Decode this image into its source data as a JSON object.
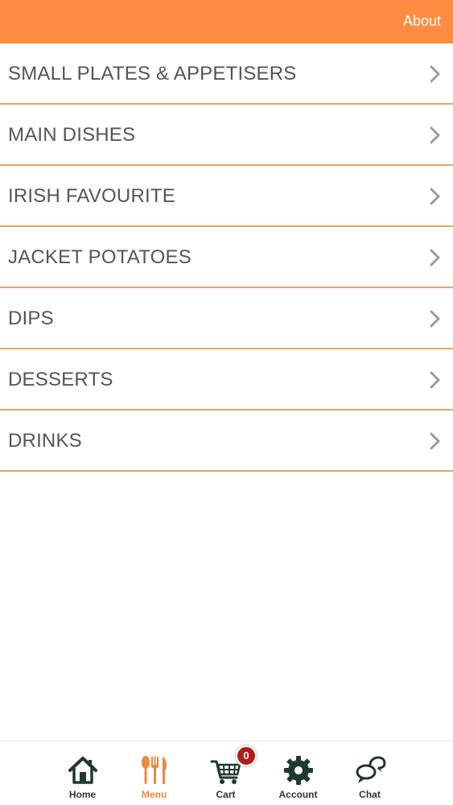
{
  "header": {
    "about_label": "About",
    "background_color": "#ff8c40"
  },
  "menu": {
    "items": [
      {
        "label": "SMALL PLATES & APPETISERS",
        "icon": "chevron-right-icon"
      },
      {
        "label": "MAIN DISHES",
        "icon": "chevron-right-icon"
      },
      {
        "label": "IRISH FAVOURITE",
        "icon": "chevron-right-icon"
      },
      {
        "label": "JACKET POTATOES",
        "icon": "chevron-right-icon"
      },
      {
        "label": "DIPS",
        "icon": "chevron-right-icon"
      },
      {
        "label": "DESSERTS",
        "icon": "chevron-right-icon"
      },
      {
        "label": "DRINKS",
        "icon": "chevron-right-icon"
      }
    ],
    "divider_color": "#e6a36e",
    "text_color": "#555555"
  },
  "tabbar": {
    "tabs": [
      {
        "label": "Home",
        "icon": "home-icon",
        "active": false
      },
      {
        "label": "Menu",
        "icon": "fork-knife-icon",
        "active": true
      },
      {
        "label": "Cart",
        "icon": "cart-icon",
        "active": false
      },
      {
        "label": "Account",
        "icon": "gear-icon",
        "active": false
      },
      {
        "label": "Chat",
        "icon": "chat-bubbles-icon",
        "active": false
      }
    ],
    "cart_count": "0",
    "active_color": "#f0883e",
    "icon_color": "#1f3a2c",
    "badge_color": "#b31b1b"
  }
}
